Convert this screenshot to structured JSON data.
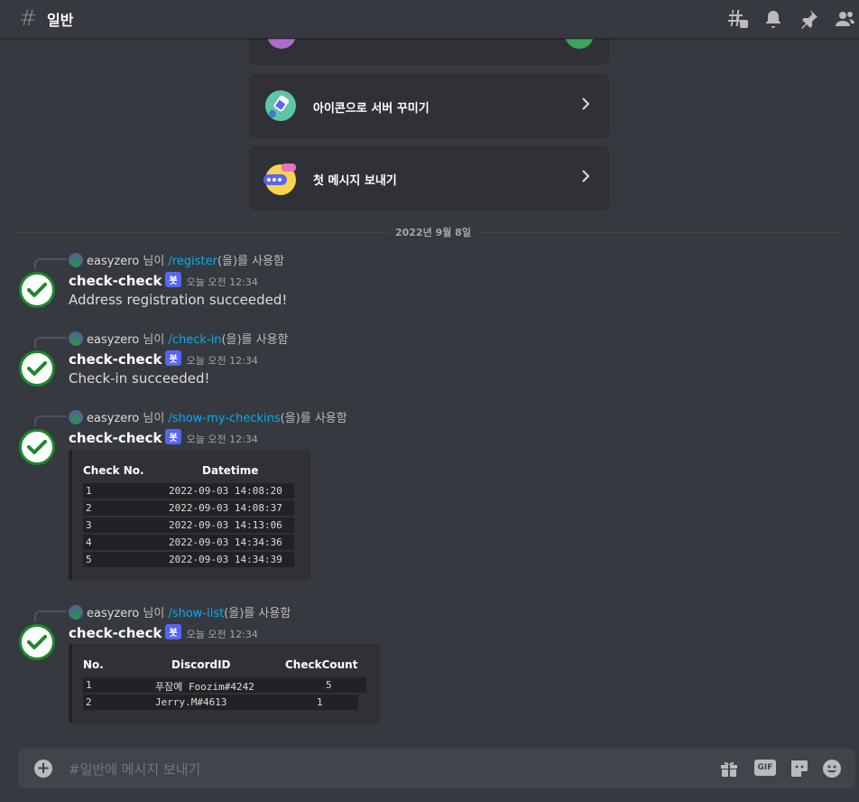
{
  "header": {
    "channel_icon": "#",
    "channel_name": "일반",
    "icons": [
      "threads-icon",
      "bell-icon",
      "pin-icon",
      "members-icon"
    ]
  },
  "cards": [
    {
      "label": "아이콘으로 서버 꾸미기",
      "icon": "paintbrush-icon"
    },
    {
      "label": "첫 메시지 보내기",
      "icon": "chat-bubble-icon"
    }
  ],
  "date_divider": "2022년 9월 8일",
  "messages": [
    {
      "reply_user": "easyzero",
      "reply_mid": " 님이 ",
      "reply_cmd": "/register",
      "reply_end": "(을)를 사용함",
      "author": "check-check",
      "badge": "봇",
      "time": "오늘 오전 12:34",
      "content": "Address registration succeeded!"
    },
    {
      "reply_user": "easyzero",
      "reply_mid": " 님이 ",
      "reply_cmd": "/check-in",
      "reply_end": "(을)를 사용함",
      "author": "check-check",
      "badge": "봇",
      "time": "오늘 오전 12:34",
      "content": "Check-in succeeded!"
    },
    {
      "reply_user": "easyzero",
      "reply_mid": " 님이 ",
      "reply_cmd": "/show-my-checkins",
      "reply_end": "(을)를 사용함",
      "author": "check-check",
      "badge": "봇",
      "time": "오늘 오전 12:34",
      "table": {
        "headers": [
          "Check No.",
          "Datetime"
        ],
        "rows": [
          [
            "1",
            "2022-09-03 14:08:20"
          ],
          [
            "2",
            "2022-09-03 14:08:37"
          ],
          [
            "3",
            "2022-09-03 14:13:06"
          ],
          [
            "4",
            "2022-09-03 14:34:36"
          ],
          [
            "5",
            "2022-09-03 14:34:39"
          ]
        ]
      }
    },
    {
      "reply_user": "easyzero",
      "reply_mid": " 님이 ",
      "reply_cmd": "/show-list",
      "reply_end": "(을)를 사용함",
      "author": "check-check",
      "badge": "봇",
      "time": "오늘 오전 12:34",
      "table": {
        "headers": [
          "No.",
          "DiscordID",
          "CheckCount"
        ],
        "rows": [
          [
            "1",
            "푸잠예 Foozim#4242",
            "5"
          ],
          [
            "2",
            "Jerry.M#4613",
            "1"
          ]
        ]
      }
    }
  ],
  "composer": {
    "placeholder": "#일반에 메시지 보내기",
    "gif_label": "GIF",
    "icons": [
      "add-icon",
      "gift-icon",
      "gif-icon",
      "sticker-icon",
      "emoji-icon"
    ]
  },
  "colors": {
    "background": "#36393f",
    "embed": "#2f3136",
    "link": "#00aff4",
    "bot_badge": "#5865f2",
    "avatar_check": "#1a8a2a"
  }
}
